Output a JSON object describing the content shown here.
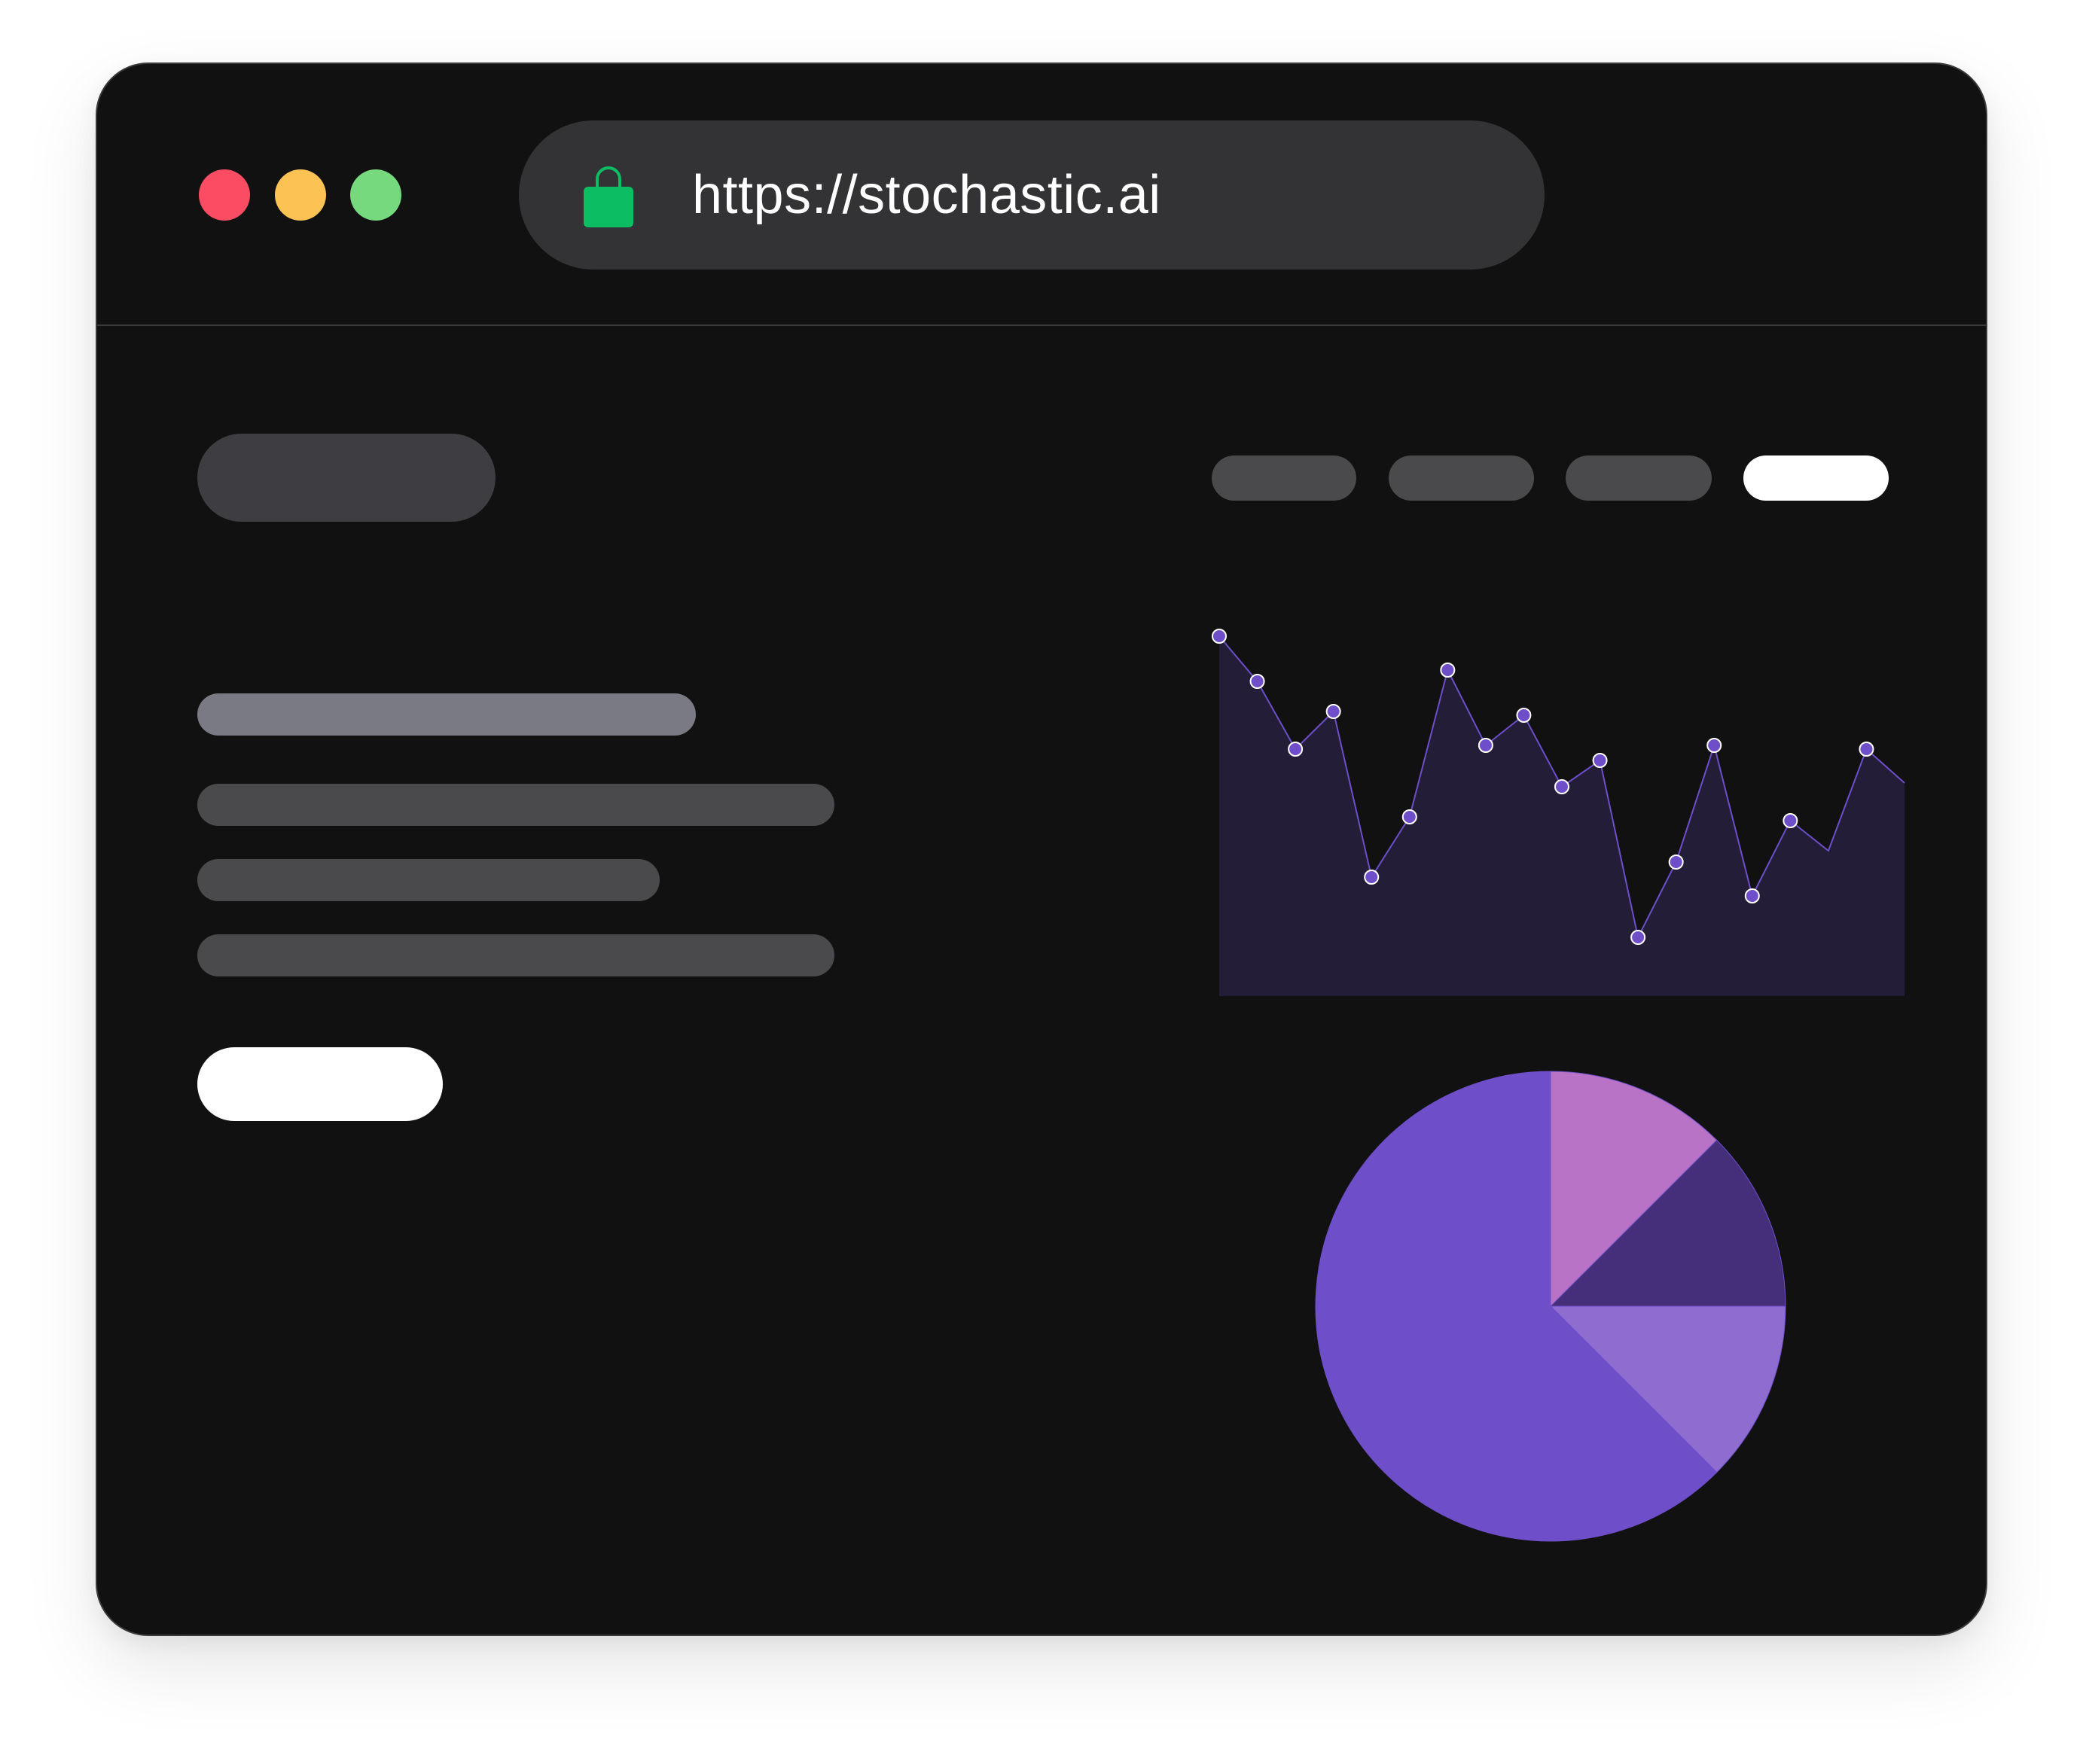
{
  "browser": {
    "url": "https://stochastic.ai",
    "lock_icon": "lock-icon",
    "traffic_lights": [
      {
        "name": "close",
        "color": "#fa4d63"
      },
      {
        "name": "minimize",
        "color": "#fcc254"
      },
      {
        "name": "maximize",
        "color": "#76d97d"
      }
    ]
  },
  "colors": {
    "window_bg": "#111111",
    "placeholder_dark": "#3e3e42",
    "placeholder_mid": "#4a4a4d",
    "placeholder_light": "#7a7a84",
    "white": "#ffffff",
    "accent": "#6e4ec9",
    "lock_green": "#0cbd63"
  },
  "chart_data": [
    {
      "type": "area",
      "values": [
        92,
        80,
        62,
        72,
        28,
        44,
        83,
        63,
        71,
        52,
        59,
        12,
        32,
        63,
        23,
        43,
        35,
        62,
        53
      ],
      "ylim": [
        0,
        100
      ],
      "point_color": "#6e4ec9",
      "fill_color": "#231d38",
      "line_color": "#6e4ec9"
    },
    {
      "type": "pie",
      "values": [
        12.5,
        12.5,
        12.5,
        62.5
      ],
      "colors": [
        "#b873c6",
        "#462f7a",
        "#8f6dd0",
        "#6e4ec9"
      ]
    }
  ]
}
